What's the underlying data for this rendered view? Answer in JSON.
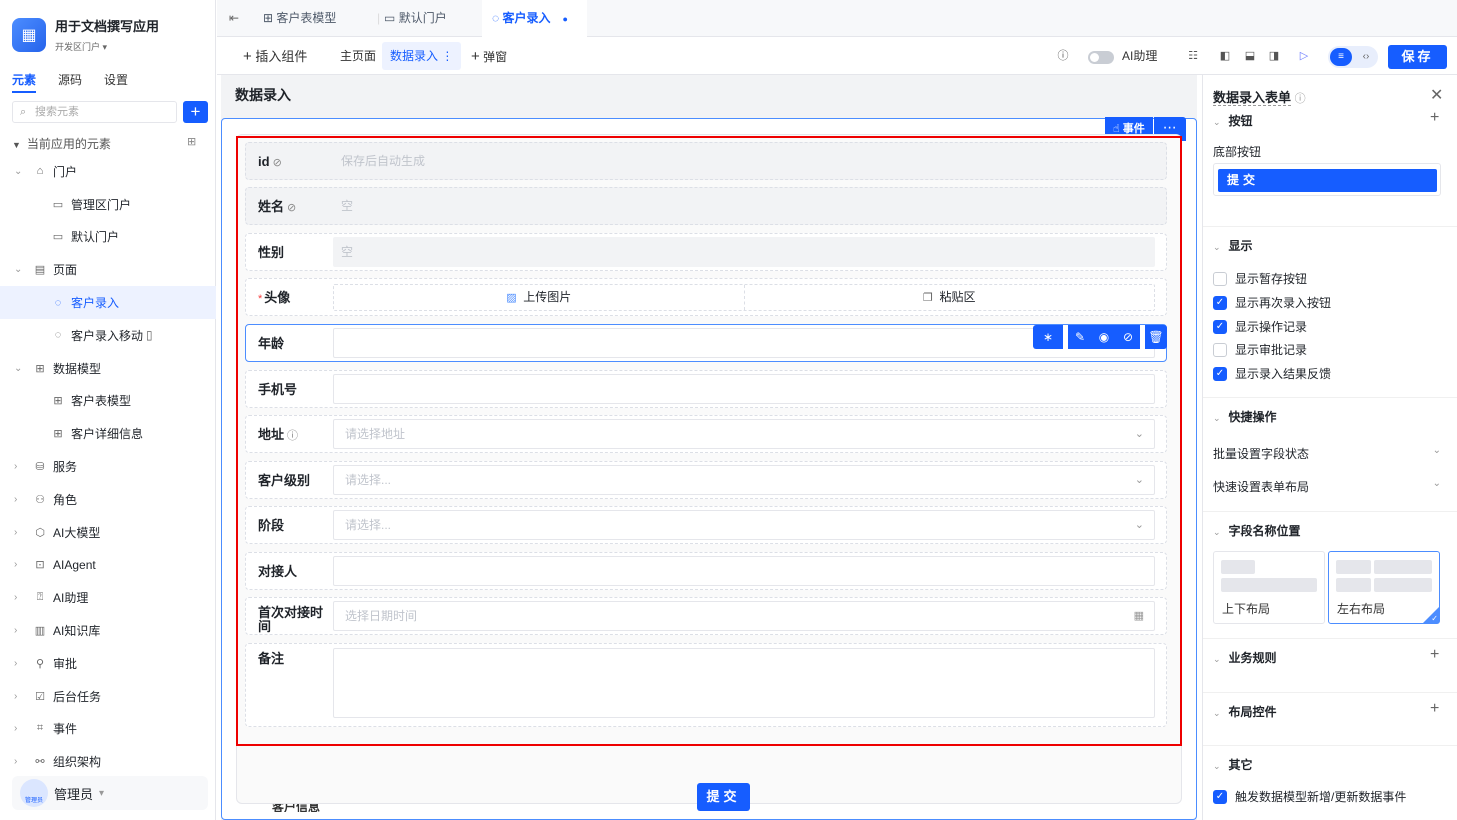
{
  "app": {
    "title": "用于文档撰写应用",
    "subtitle": "开发区门户"
  },
  "left_tabs": [
    "元素",
    "源码",
    "设置"
  ],
  "search": {
    "placeholder": "搜索元素"
  },
  "section_label": "当前应用的元素",
  "tree": [
    {
      "label": "门户",
      "icon": "home-icon",
      "level": 0,
      "expand": "open"
    },
    {
      "label": "管理区门户",
      "icon": "portal-icon",
      "level": 1
    },
    {
      "label": "默认门户",
      "icon": "portal-icon",
      "level": 1
    },
    {
      "label": "页面",
      "icon": "page-icon",
      "level": 0,
      "expand": "open"
    },
    {
      "label": "客户录入",
      "icon": "form-page-icon",
      "level": 1,
      "active": true
    },
    {
      "label": "客户录入移动",
      "icon": "form-page-icon",
      "level": 1,
      "mobile": true
    },
    {
      "label": "数据模型",
      "icon": "table-icon",
      "level": 0,
      "expand": "open"
    },
    {
      "label": "客户表模型",
      "icon": "table-icon",
      "level": 1
    },
    {
      "label": "客户详细信息",
      "icon": "table-icon",
      "level": 1
    },
    {
      "label": "服务",
      "icon": "service-icon",
      "level": 0,
      "expand": "closed"
    },
    {
      "label": "角色",
      "icon": "role-icon",
      "level": 0,
      "expand": "closed"
    },
    {
      "label": "AI大模型",
      "icon": "model-icon",
      "level": 0,
      "expand": "closed"
    },
    {
      "label": "AIAgent",
      "icon": "robot-icon",
      "level": 0,
      "expand": "closed"
    },
    {
      "label": "AI助理",
      "icon": "assistant-icon",
      "level": 0,
      "expand": "closed"
    },
    {
      "label": "AI知识库",
      "icon": "book-icon",
      "level": 0,
      "expand": "closed"
    },
    {
      "label": "审批",
      "icon": "stamp-icon",
      "level": 0,
      "expand": "closed"
    },
    {
      "label": "后台任务",
      "icon": "task-icon",
      "level": 0,
      "expand": "closed"
    },
    {
      "label": "事件",
      "icon": "event-icon",
      "level": 0,
      "expand": "closed"
    },
    {
      "label": "组织架构",
      "icon": "org-icon",
      "level": 0,
      "expand": "closed"
    }
  ],
  "user": {
    "avatar_text": "管理员",
    "name": "管理员"
  },
  "top_tabs": [
    {
      "label": "客户表模型",
      "icon": "table-icon"
    },
    {
      "label": "默认门户",
      "icon": "portal-icon"
    },
    {
      "label": "客户录入",
      "icon": "form-page-icon",
      "active": true
    }
  ],
  "toolbar": {
    "insert": "插入组件",
    "home": "主页面",
    "data_entry": "数据录入",
    "popup": "弹窗",
    "ai_assistant": "AI助理",
    "save": "保存"
  },
  "page_title": "数据录入",
  "canvas": {
    "event_label": "事件"
  },
  "form": {
    "fields": [
      {
        "label": "id",
        "value_placeholder": "保存后自动生成",
        "hidden_icon": true,
        "style": "gray-row"
      },
      {
        "label": "姓名",
        "value_placeholder": "空",
        "hidden_icon": true,
        "style": "gray-row"
      },
      {
        "label": "性别",
        "value_placeholder": "空",
        "style": "gray-input"
      },
      {
        "label": "头像",
        "required": true,
        "style": "upload",
        "upload_label": "上传图片",
        "paste_label": "粘贴区"
      },
      {
        "label": "年龄",
        "value_placeholder": "",
        "style": "selected"
      },
      {
        "label": "手机号",
        "value_placeholder": ""
      },
      {
        "label": "地址",
        "value_placeholder": "请选择地址",
        "help_icon": true,
        "dropdown": true
      },
      {
        "label": "客户级别",
        "value_placeholder": "请选择...",
        "dropdown": true
      },
      {
        "label": "阶段",
        "value_placeholder": "请选择...",
        "dropdown": true
      },
      {
        "label": "对接人",
        "value_placeholder": ""
      },
      {
        "label": "首次对接时间",
        "value_placeholder": "选择日期时间",
        "calendar": true
      },
      {
        "label": "备注",
        "value_placeholder": "",
        "textarea": true
      }
    ],
    "cut_label": "客户信息",
    "submit": "提交"
  },
  "right_panel": {
    "title": "数据录入表单",
    "buttons_section": "按钮",
    "bottom_buttons_label": "底部按钮",
    "submit_button": "提交",
    "display_section": "显示",
    "display_options": [
      {
        "label": "显示暂存按钮",
        "checked": false
      },
      {
        "label": "显示再次录入按钮",
        "checked": true
      },
      {
        "label": "显示操作记录",
        "checked": true
      },
      {
        "label": "显示审批记录",
        "checked": false
      },
      {
        "label": "显示录入结果反馈",
        "checked": true
      }
    ],
    "quick_section": "快捷操作",
    "quick_items": [
      "批量设置字段状态",
      "快速设置表单布局"
    ],
    "label_pos_section": "字段名称位置",
    "layouts": [
      {
        "label": "上下布局",
        "selected": false
      },
      {
        "label": "左右布局",
        "selected": true
      }
    ],
    "biz_rules": "业务规则",
    "layout_ctrl": "布局控件",
    "other": "其它",
    "other_option": {
      "label": "触发数据模型新增/更新数据事件",
      "checked": true
    }
  },
  "colors": {
    "accent": "#165dff",
    "selection_outline": "#e00000"
  }
}
